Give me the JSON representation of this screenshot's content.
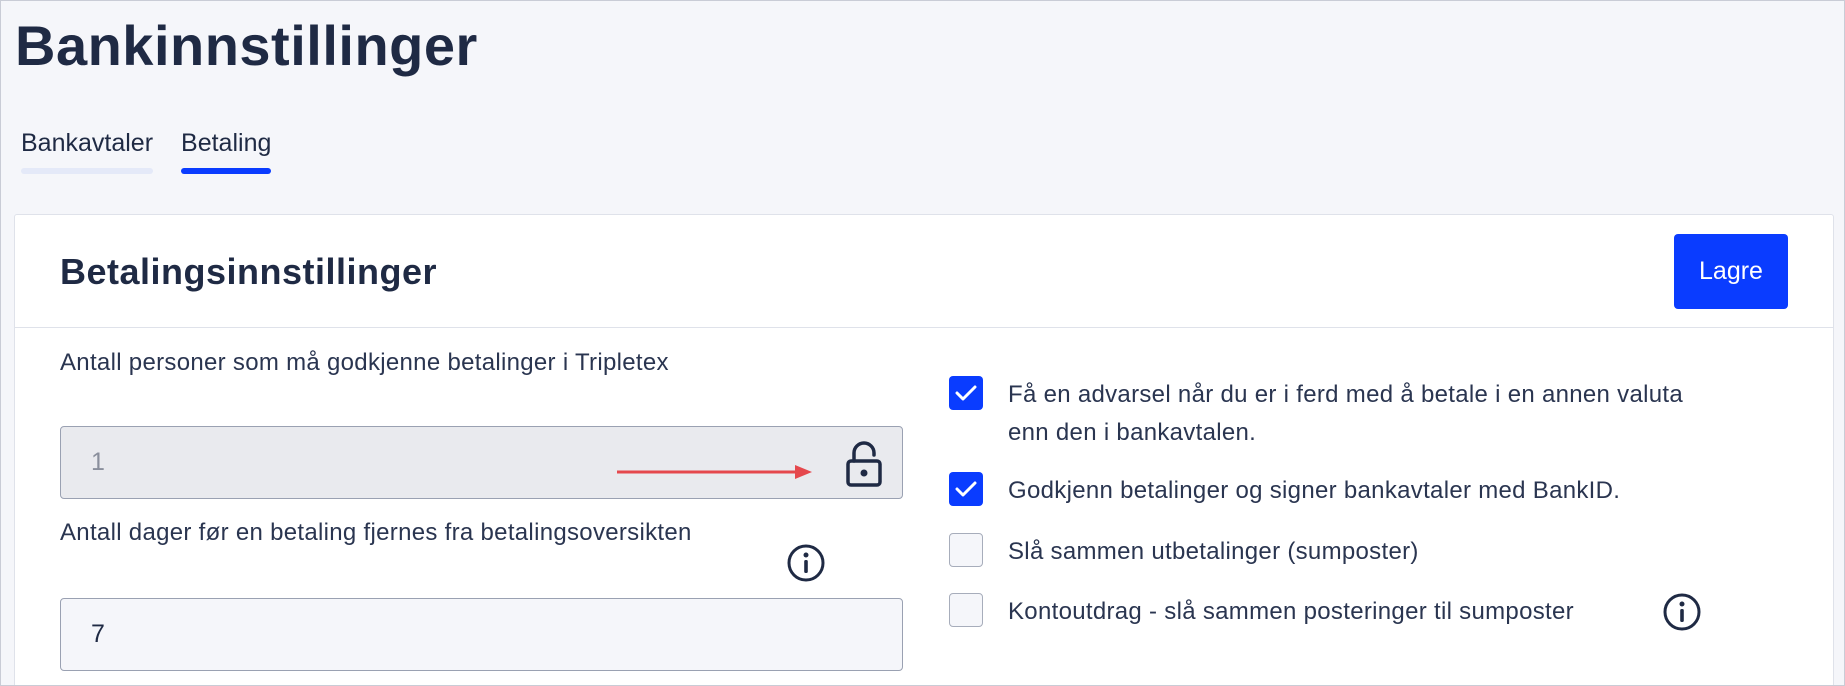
{
  "page": {
    "title": "Bankinnstillinger"
  },
  "tabs": [
    {
      "label": "Bankavtaler",
      "active": false
    },
    {
      "label": "Betaling",
      "active": true
    }
  ],
  "card": {
    "title": "Betalingsinnstillinger",
    "save_label": "Lagre"
  },
  "fields": {
    "approvers": {
      "label": "Antall personer som må godkjenne betalinger i Tripletex",
      "value": "1",
      "locked": true
    },
    "days_removed": {
      "label": "Antall dager før en betaling fjernes fra betalingsoversikten",
      "value": "7"
    }
  },
  "options": [
    {
      "label_line1": "Få en advarsel når du er i ferd med å betale i en annen valuta",
      "label_line2": "enn den i bankavtalen.",
      "checked": true
    },
    {
      "label": "Godkjenn betalinger og signer bankavtaler med BankID.",
      "checked": true
    },
    {
      "label": "Slå sammen utbetalinger (sumposter)",
      "checked": false
    },
    {
      "label": "Kontoutdrag - slå sammen posteringer til sumposter",
      "checked": false
    }
  ],
  "colors": {
    "primary": "#0a3cff",
    "annotation_arrow": "#e5484d"
  },
  "icons": {
    "lock": "unlocked-padlock-icon",
    "info": "info-circle-icon",
    "check": "checkmark-icon"
  }
}
